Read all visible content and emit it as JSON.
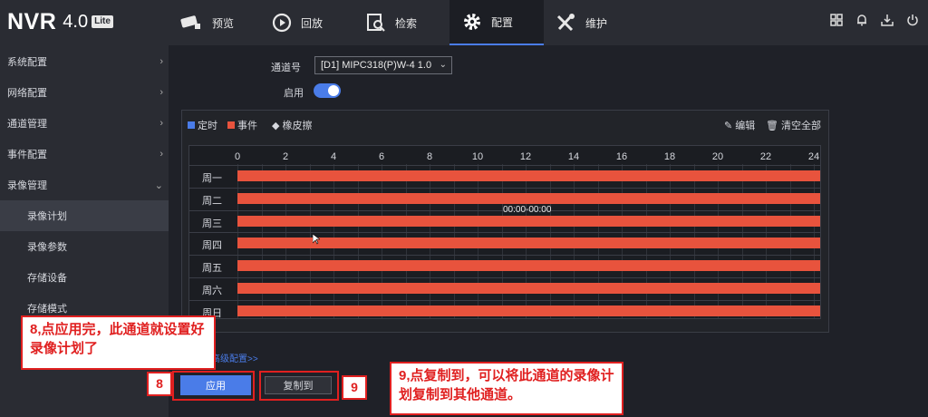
{
  "app": {
    "logo_main": "NVR",
    "logo_version": "4.0",
    "logo_badge": "Lite"
  },
  "nav_tabs": [
    {
      "label": "预览",
      "icon": "camera-icon"
    },
    {
      "label": "回放",
      "icon": "playback-icon"
    },
    {
      "label": "检索",
      "icon": "search-file-icon"
    },
    {
      "label": "配置",
      "icon": "gear-icon",
      "active": true
    },
    {
      "label": "维护",
      "icon": "wrench-icon"
    }
  ],
  "top_icons": [
    "layout-icon",
    "bell-icon",
    "download-icon",
    "power-icon"
  ],
  "sidebar": {
    "items": [
      {
        "label": "系统配置",
        "chevron": "›"
      },
      {
        "label": "网络配置",
        "chevron": "›"
      },
      {
        "label": "通道管理",
        "chevron": "›"
      },
      {
        "label": "事件配置",
        "chevron": "›"
      },
      {
        "label": "录像管理",
        "chevron": "⌄"
      }
    ],
    "sub_items": [
      {
        "label": "录像计划",
        "active": true
      },
      {
        "label": "录像参数"
      },
      {
        "label": "存储设备"
      },
      {
        "label": "存储模式"
      }
    ]
  },
  "form": {
    "channel_label": "通道号",
    "channel_value": "[D1] MIPC318(P)W-4 1.0",
    "enable_label": "启用"
  },
  "toolbar": {
    "timed_label": "定时",
    "event_label": "事件",
    "eraser_label": "橡皮擦",
    "edit_label": "编辑",
    "clear_label": "清空全部"
  },
  "schedule": {
    "hours": [
      "0",
      "2",
      "4",
      "6",
      "8",
      "10",
      "12",
      "14",
      "16",
      "18",
      "20",
      "22",
      "24"
    ],
    "days": [
      "周一",
      "周二",
      "周三",
      "周四",
      "周五",
      "周六",
      "周日"
    ],
    "range_label": "00:00-00:00"
  },
  "colors": {
    "timed": "#4a7ce8",
    "event": "#e8533d",
    "accent": "#4a7ce8",
    "annotation": "#e02020"
  },
  "advanced_link": "高级配置>>",
  "buttons": {
    "apply": "应用",
    "copy_to": "复制到"
  },
  "annotations": {
    "step8_num": "8",
    "step8_text": "8,点应用完，此通道就设置好录像计划了",
    "step9_num": "9",
    "step9_text": "9,点复制到，可以将此通道的录像计划复制到其他通道。"
  }
}
